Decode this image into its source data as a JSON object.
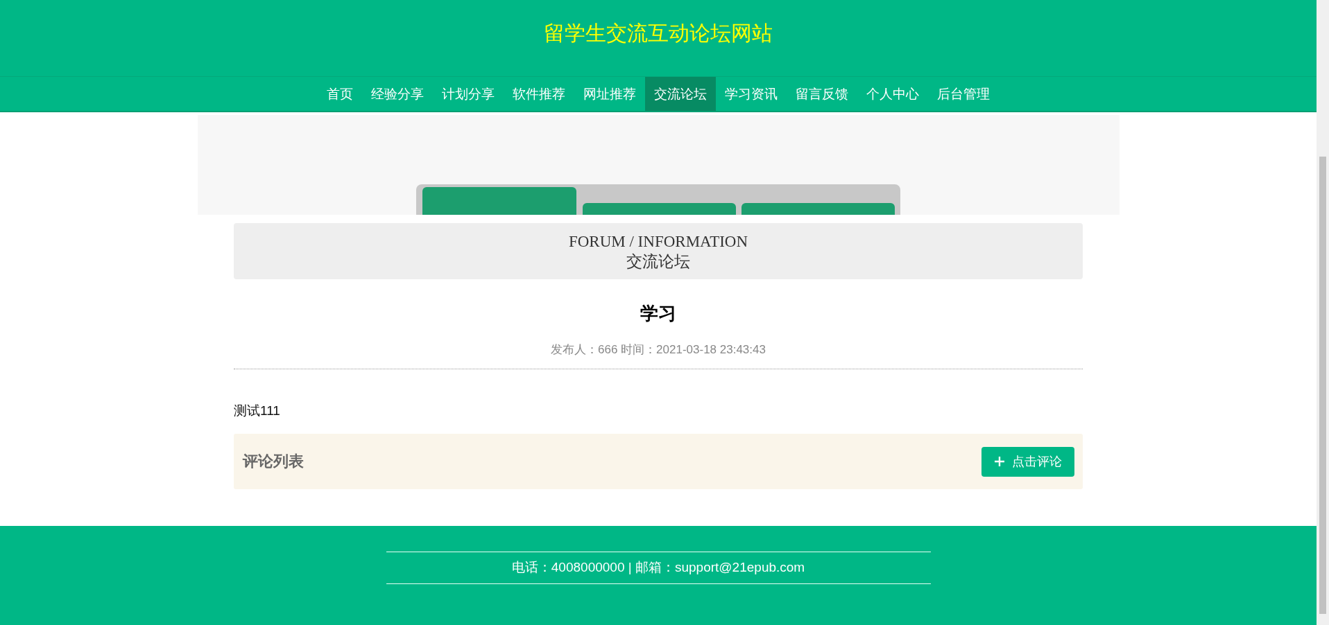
{
  "site_title": "留学生交流互动论坛网站",
  "nav": [
    {
      "label": "首页",
      "selected": false
    },
    {
      "label": "经验分享",
      "selected": false
    },
    {
      "label": "计划分享",
      "selected": false
    },
    {
      "label": "软件推荐",
      "selected": false
    },
    {
      "label": "网址推荐",
      "selected": false
    },
    {
      "label": "交流论坛",
      "selected": true
    },
    {
      "label": "学习资讯",
      "selected": false
    },
    {
      "label": "留言反馈",
      "selected": false
    },
    {
      "label": "个人中心",
      "selected": false
    },
    {
      "label": "后台管理",
      "selected": false
    }
  ],
  "section": {
    "title_en": "FORUM / INFORMATION",
    "title_cn": "交流论坛"
  },
  "post": {
    "title": "学习",
    "meta": "发布人：666 时间：2021-03-18 23:43:43",
    "body": "测试111"
  },
  "comments": {
    "heading": "评论列表",
    "button": "点击评论"
  },
  "footer": {
    "contact": "电话：4008000000 | 邮箱：support@21epub.com"
  }
}
